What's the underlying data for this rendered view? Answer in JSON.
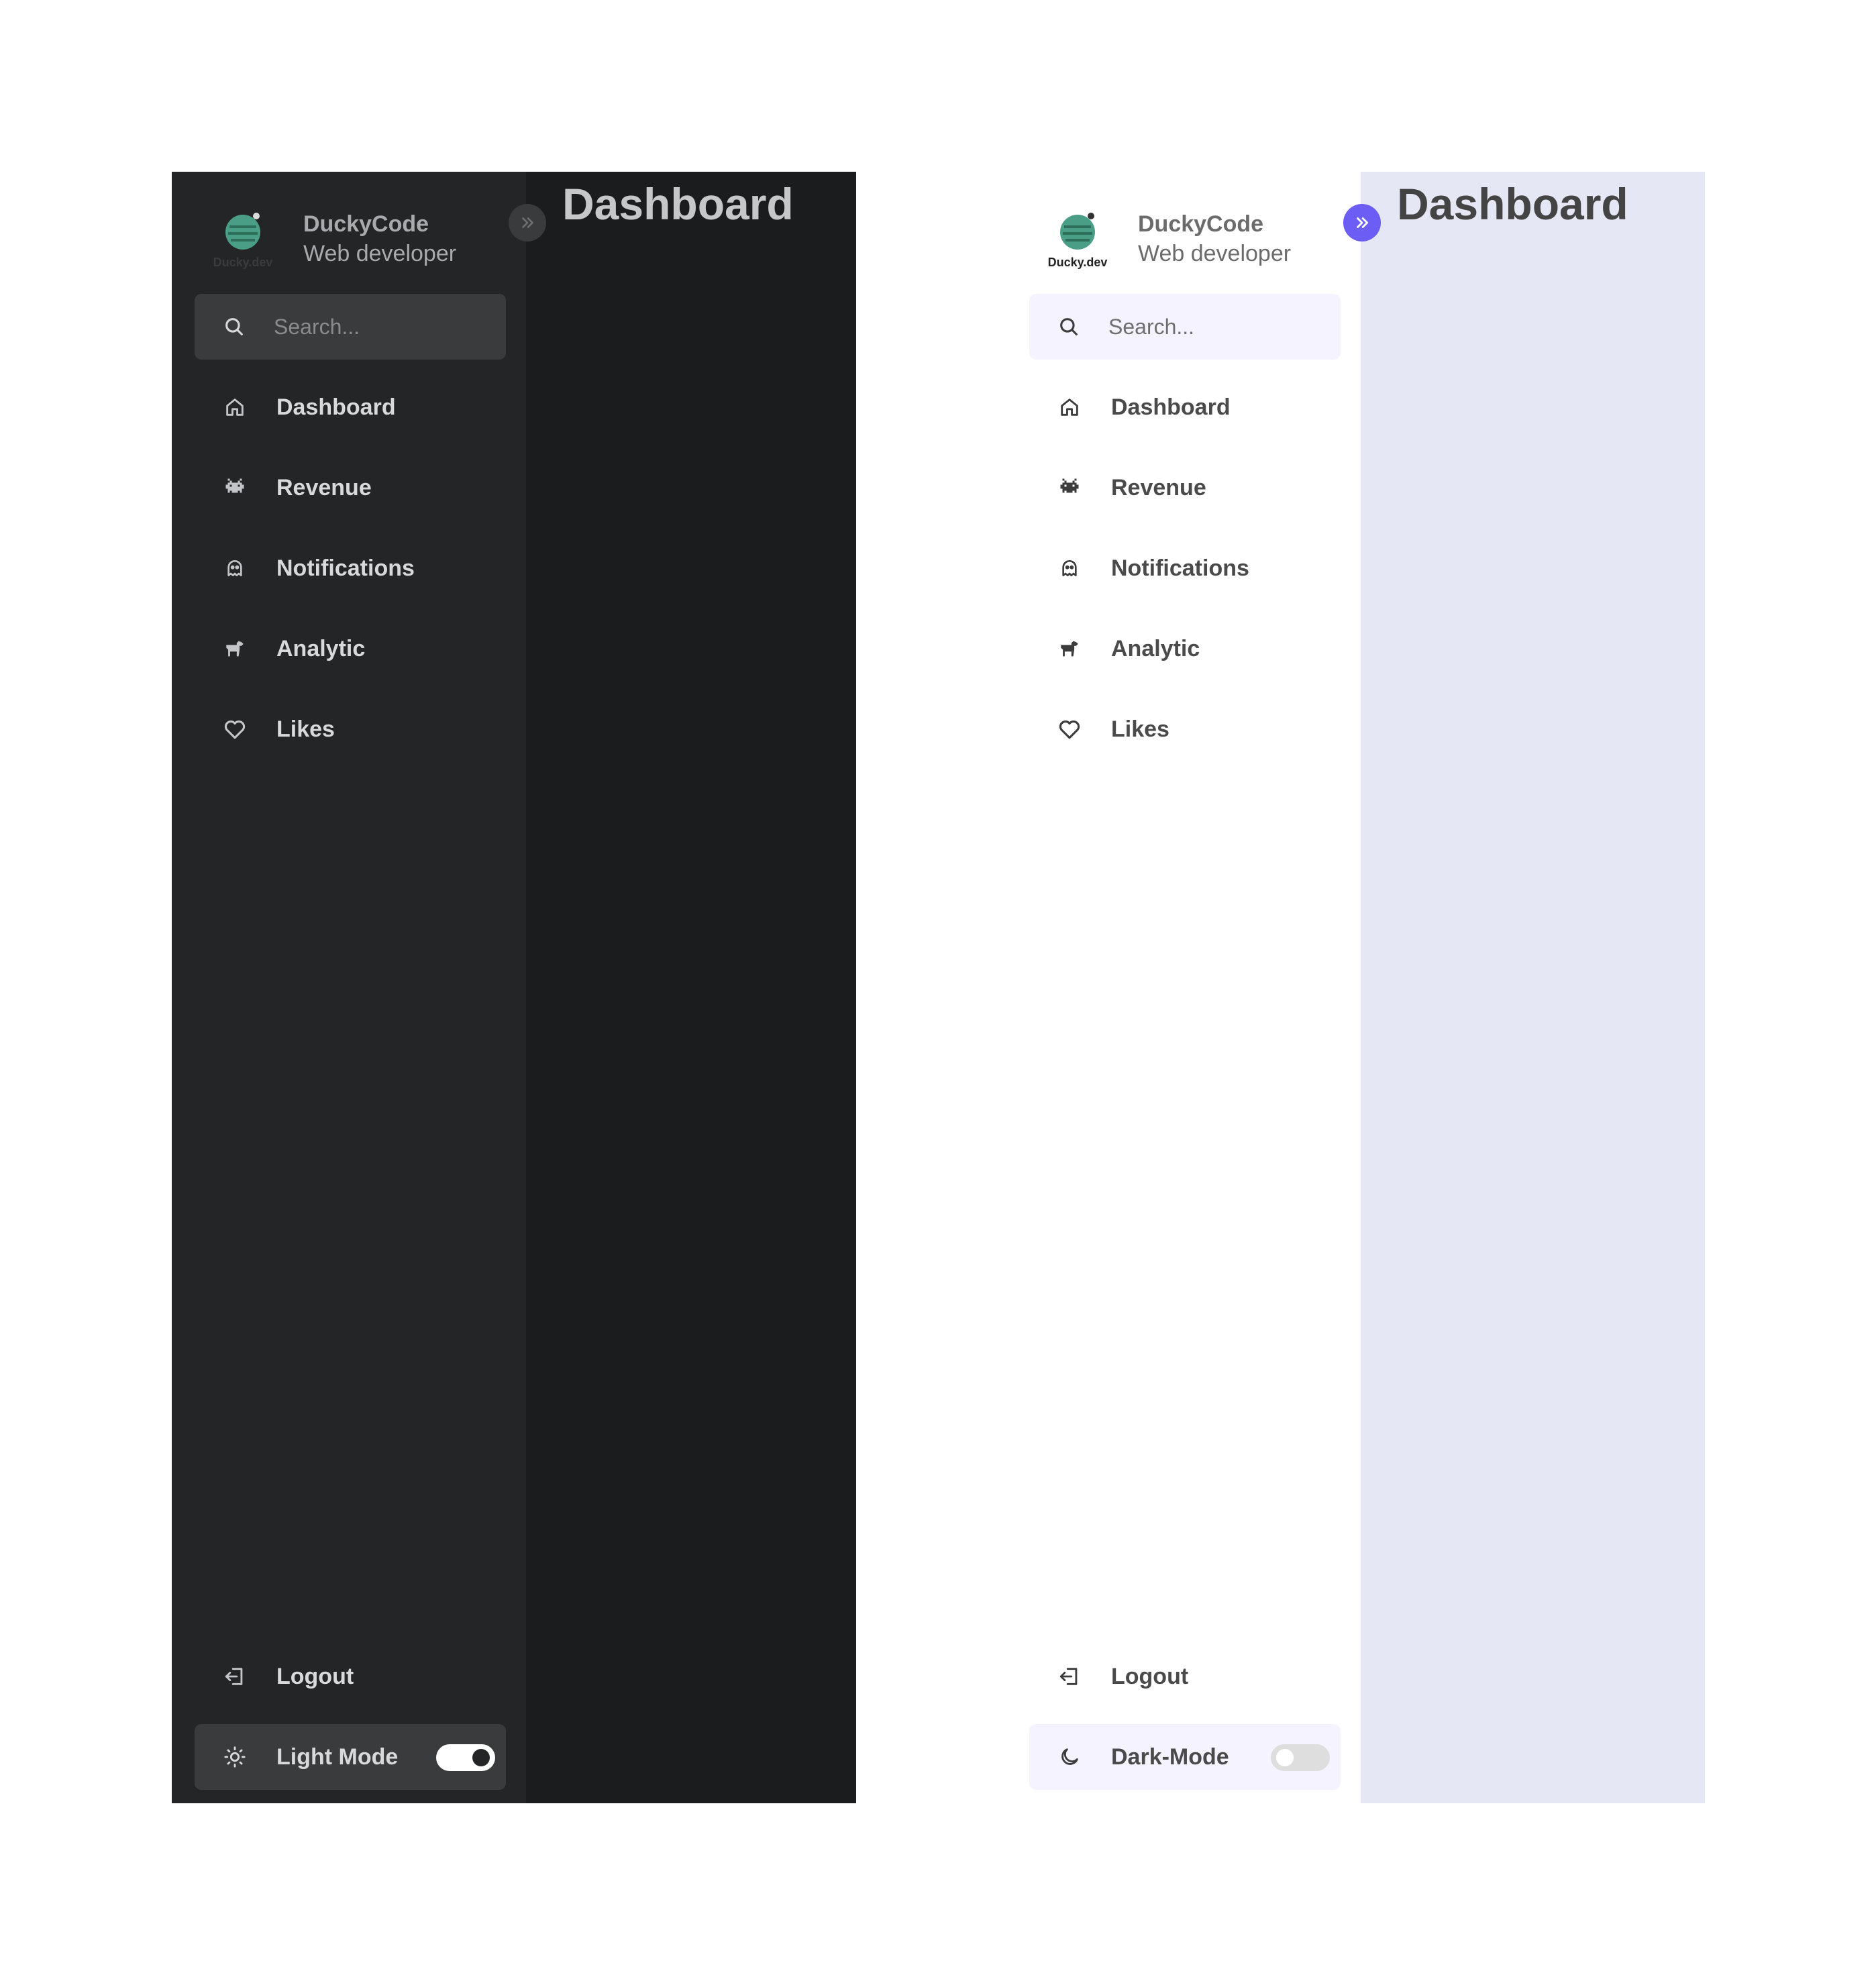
{
  "dark": {
    "brand": {
      "name": "DuckyCode",
      "role": "Web developer",
      "logo_text": "Ducky.dev"
    },
    "search": {
      "placeholder": "Search..."
    },
    "nav": [
      {
        "label": "Dashboard",
        "icon": "home-icon"
      },
      {
        "label": "Revenue",
        "icon": "space-invader-icon"
      },
      {
        "label": "Notifications",
        "icon": "ghost-icon"
      },
      {
        "label": "Analytic",
        "icon": "dog-icon"
      },
      {
        "label": "Likes",
        "icon": "heart-icon"
      }
    ],
    "logout_label": "Logout",
    "mode_label": "Light Mode",
    "mode_switch_on": true,
    "main_title": "Dashboard",
    "colors": {
      "background": "#1b1c1e",
      "sidebar": "#242527"
    }
  },
  "light": {
    "brand": {
      "name": "DuckyCode",
      "role": "Web developer",
      "logo_text": "Ducky.dev"
    },
    "search": {
      "placeholder": "Search..."
    },
    "nav": [
      {
        "label": "Dashboard",
        "icon": "home-icon"
      },
      {
        "label": "Revenue",
        "icon": "space-invader-icon"
      },
      {
        "label": "Notifications",
        "icon": "ghost-icon"
      },
      {
        "label": "Analytic",
        "icon": "dog-icon"
      },
      {
        "label": "Likes",
        "icon": "heart-icon"
      }
    ],
    "logout_label": "Logout",
    "mode_label": "Dark-Mode",
    "mode_switch_on": false,
    "main_title": "Dashboard",
    "colors": {
      "background": "#e6e7f5",
      "sidebar": "#ffffff",
      "accent": "#6c5ef5"
    }
  }
}
